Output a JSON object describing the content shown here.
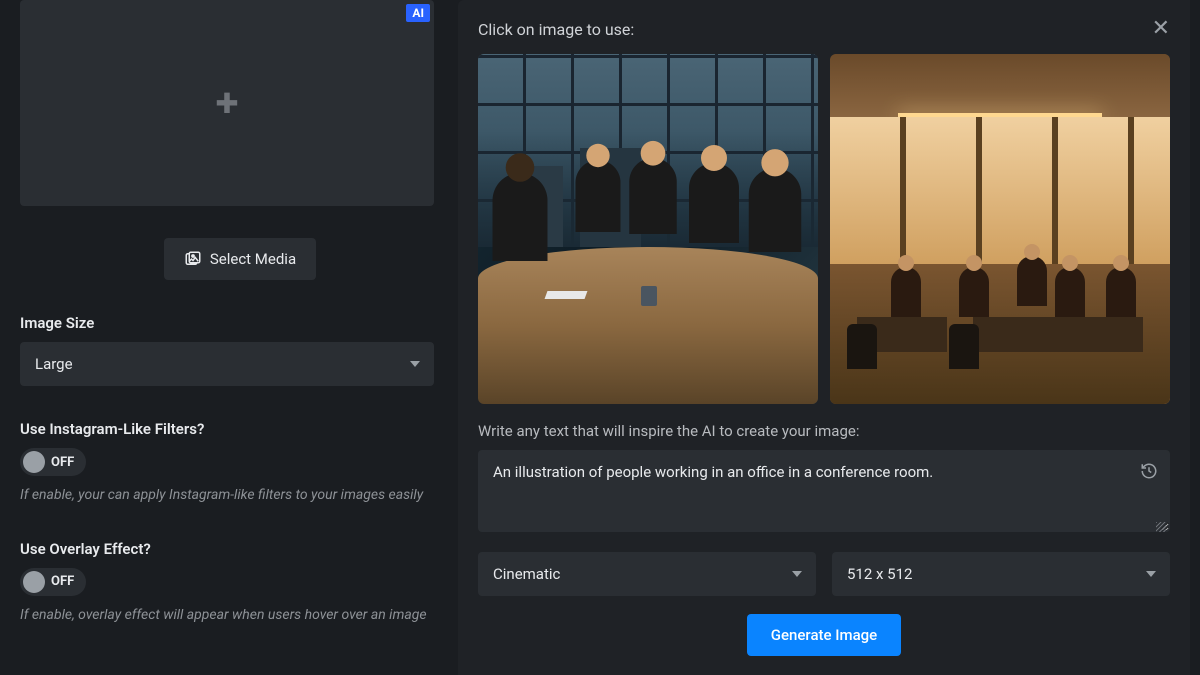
{
  "left": {
    "ai_badge": "AI",
    "select_media": "Select Media",
    "image_size_label": "Image Size",
    "image_size_value": "Large",
    "filters_label": "Use Instagram-Like Filters?",
    "filters_toggle": "OFF",
    "filters_help": "If enable, your can apply Instagram-like filters to your images easily",
    "overlay_label": "Use Overlay Effect?",
    "overlay_toggle": "OFF",
    "overlay_help": "If enable, overlay effect will appear when users hover over an image"
  },
  "dialog": {
    "title": "Click on image to use:",
    "prompt_label": "Write any text that will inspire the AI to create your image:",
    "prompt_value": "An illustration of people working in an office in a conference room.",
    "style_value": "Cinematic",
    "size_value": "512 x 512",
    "generate": "Generate Image"
  }
}
